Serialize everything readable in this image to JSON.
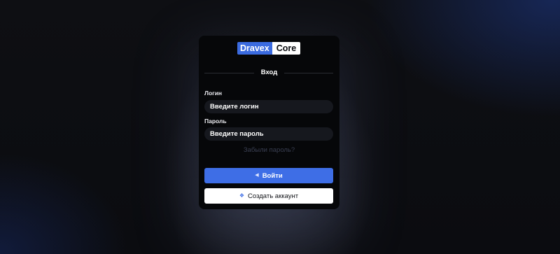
{
  "logo": {
    "part1": "Dravex",
    "part2": "Core"
  },
  "section_title": "Вход",
  "login": {
    "label": "Логин",
    "placeholder": "Введите логин"
  },
  "password": {
    "label": "Пароль",
    "placeholder": "Введите пароль"
  },
  "forgot_link": "Забыли пароль?",
  "login_button": {
    "icon": "login-arrow-icon",
    "label": "Войти"
  },
  "register_button": {
    "icon": "sparkle-icon",
    "label": "Создать аккаунт"
  },
  "colors": {
    "accent": "#3e6ee6",
    "card_background": "#060709",
    "page_background": "#0e0f13"
  }
}
